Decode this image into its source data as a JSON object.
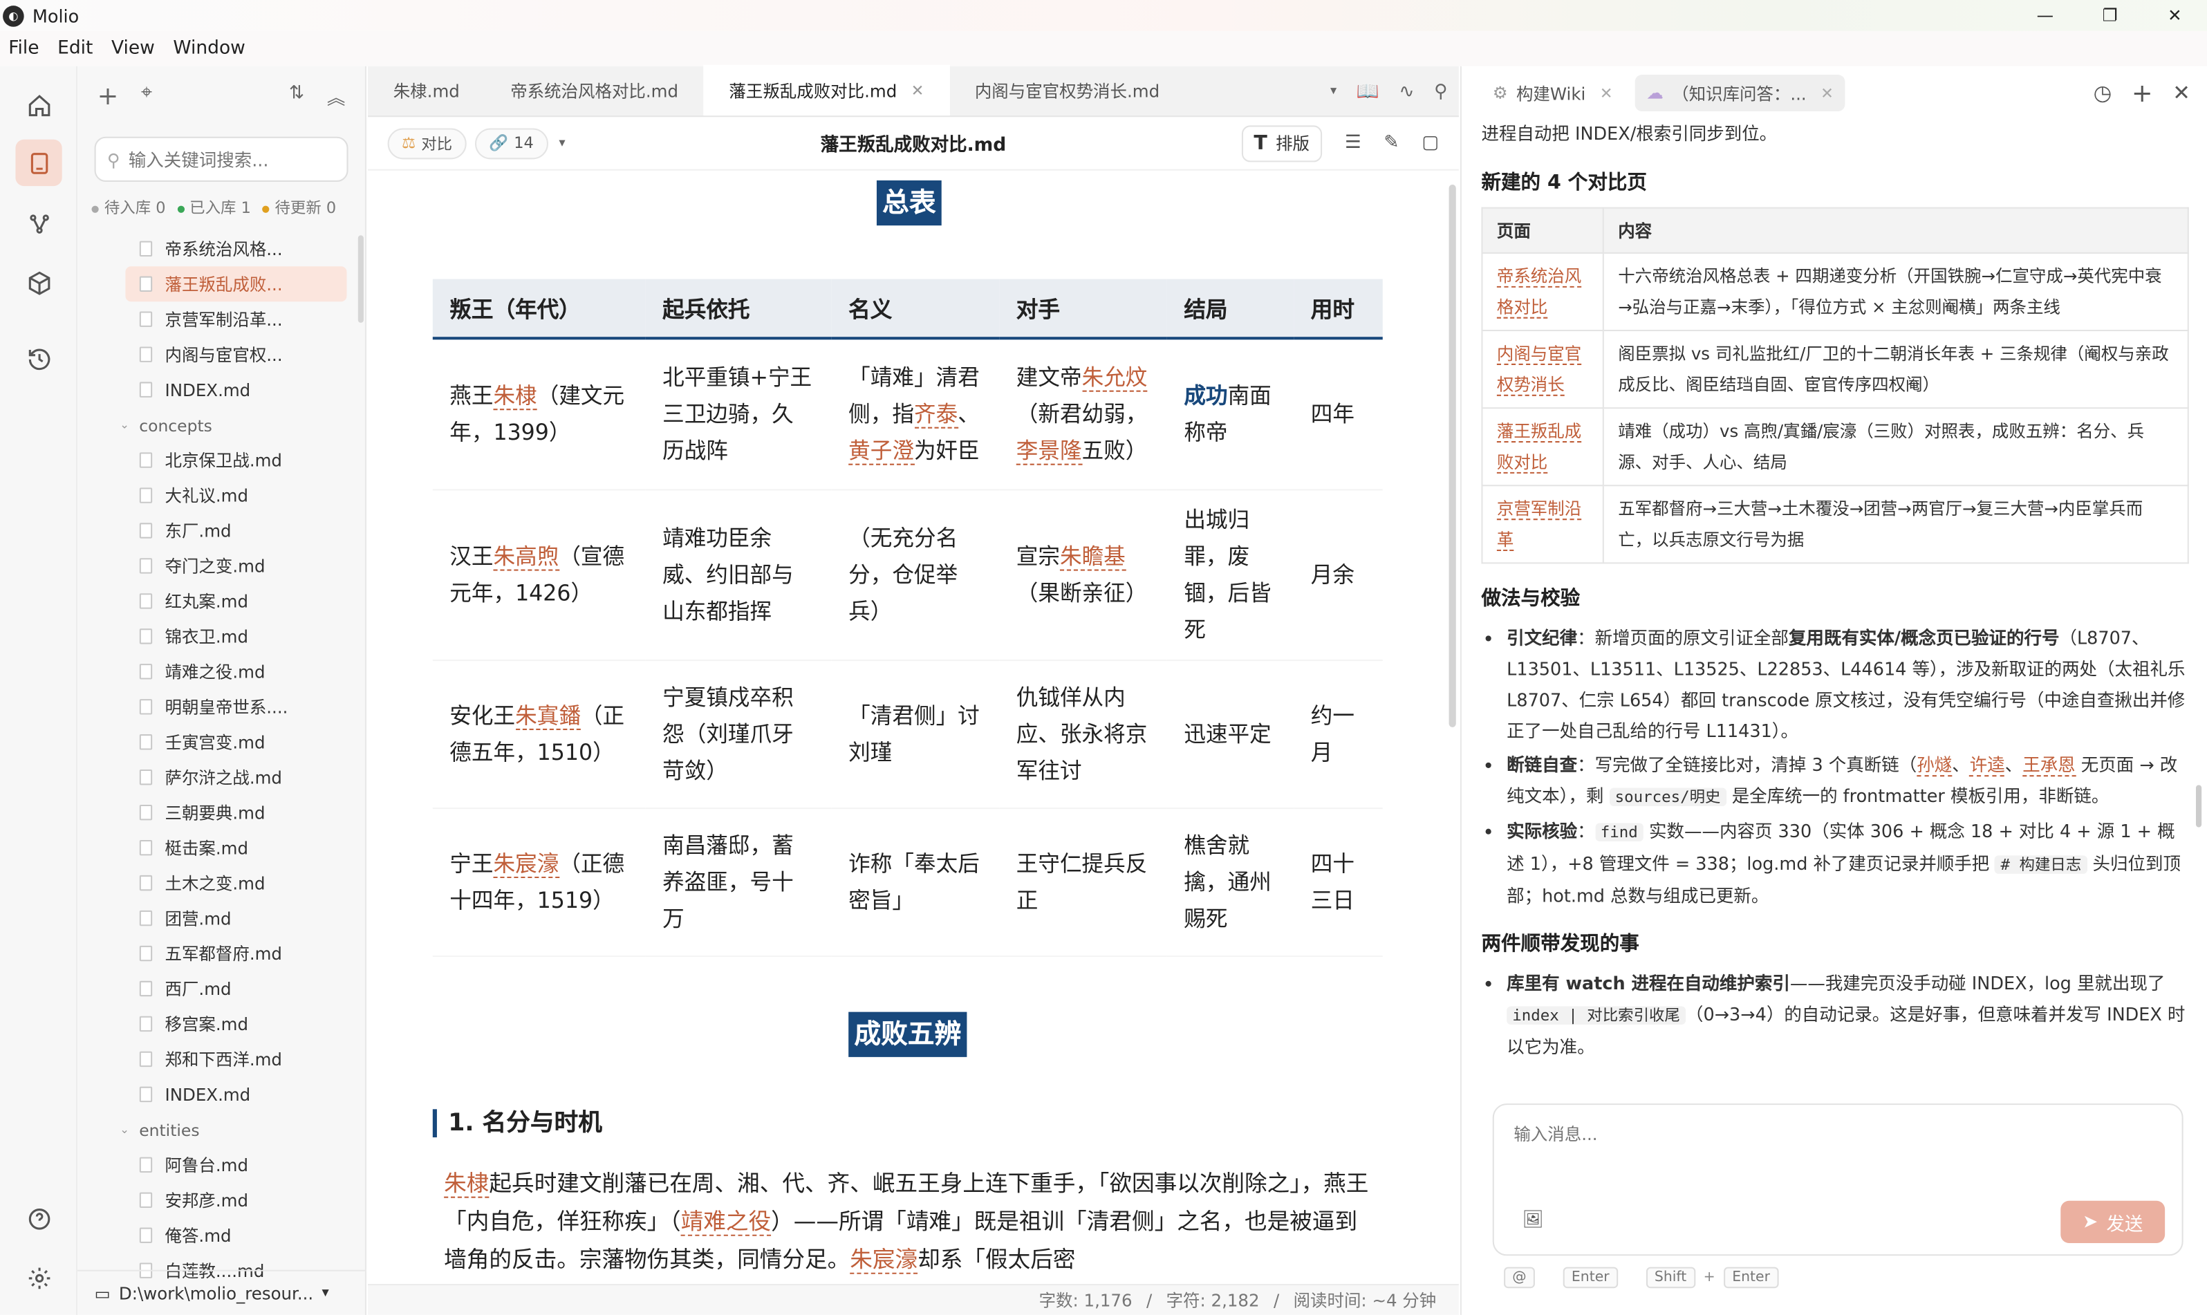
{
  "app": {
    "title": "Molio",
    "window_controls": [
      "—",
      "❐",
      "✕"
    ]
  },
  "menu": [
    "File",
    "Edit",
    "View",
    "Window"
  ],
  "filepanel": {
    "search_placeholder": "输入关键词搜索...",
    "status": {
      "pending": "待入库 0",
      "stored": "已入库 1",
      "update": "待更新 0"
    },
    "files_top": [
      "帝系统治风格...",
      "藩王叛乱成败...",
      "京营军制沿革...",
      "内阁与宦官权...",
      "INDEX.md"
    ],
    "selected_index": 1,
    "folder_concepts": "concepts",
    "concepts": [
      "北京保卫战.md",
      "大礼议.md",
      "东厂.md",
      "夺门之变.md",
      "红丸案.md",
      "锦衣卫.md",
      "靖难之役.md",
      "明朝皇帝世系....",
      "壬寅宫变.md",
      "萨尔浒之战.md",
      "三朝要典.md",
      "梃击案.md",
      "土木之变.md",
      "团营.md",
      "五军都督府.md",
      "西厂.md",
      "移宫案.md",
      "郑和下西洋.md",
      "INDEX.md"
    ],
    "folder_entities": "entities",
    "entities": [
      "阿鲁台.md",
      "安邦彦.md",
      "俺答.md",
      "白莲教....md"
    ],
    "workspace_path": "D:\\work\\molio_resour..."
  },
  "editor": {
    "tabs": [
      "朱棣.md",
      "帝系统治风格对比.md",
      "藩王叛乱成败对比.md",
      "内阁与宦官权势消长.md"
    ],
    "active_tab": 2,
    "pill_compare": "对比",
    "pill_links": "14",
    "doc_title": "藩王叛乱成败对比.md",
    "paiban": "排版",
    "banner1": "总表",
    "banner2": "成败五辨",
    "table_headers": [
      "叛王（年代）",
      "起兵依托",
      "名义",
      "对手",
      "结局",
      "用时"
    ],
    "rows": [
      {
        "c1a": "燕王",
        "c1b": "朱棣",
        "c1c": "（建文元年，1399）",
        "c2": "北平重镇+宁王三卫边骑，久历战阵",
        "c3a": "「靖难」清君侧，指",
        "c3b": "齐泰",
        "c3c": "、",
        "c3d": "黄子澄",
        "c3e": "为奸臣",
        "c4a": "建文帝",
        "c4b": "朱允炆",
        "c4c": "（新君幼弱，",
        "c4d": "李景隆",
        "c4e": "五败）",
        "c5a": "成功",
        "c5b": "南面称帝",
        "c6": "四年"
      },
      {
        "c1a": "汉王",
        "c1b": "朱高煦",
        "c1c": "（宣德元年，1426）",
        "c2": "靖难功臣余威、约旧部与山东都指挥",
        "c3": "（无充分名分，仓促举兵）",
        "c4a": "宣宗",
        "c4b": "朱瞻基",
        "c4c": "（果断亲征）",
        "c5": "出城归罪，废锢，后皆死",
        "c6": "月余"
      },
      {
        "c1a": "安化王",
        "c1b": "朱寘鐇",
        "c1c": "（正德五年，1510）",
        "c2": "宁夏镇戍卒积怨（刘瑾爪牙苛敛）",
        "c3": "「清君侧」讨刘瑾",
        "c4": "仇钺佯从内应、张永将京军往讨",
        "c5": "迅速平定",
        "c6": "约一月"
      },
      {
        "c1a": "宁王",
        "c1b": "朱宸濠",
        "c1c": "（正德十四年，1519）",
        "c2": "南昌藩邸，蓄养盗匪，号十万",
        "c3": "诈称「奉太后密旨」",
        "c4": "王守仁提兵反正",
        "c5": "樵舍就擒，通州赐死",
        "c6": "四十三日"
      }
    ],
    "section_heading": "1. 名分与时机",
    "para": {
      "a": "朱棣",
      "b": "起兵时建文削藩已在周、湘、代、齐、岷五王身上连下重手，「欲因事以次削除之」，燕王「内自危，佯狂称疾」（",
      "c": "靖难之役",
      "d": "）——所谓「靖难」既是祖训「清君侧」之名，也是被逼到墙角的反击。宗藩物伤其类，同情分足。",
      "e": "朱宸濠",
      "f": "却系「假太后密"
    },
    "status_words": "字数: 1,176",
    "status_chars": "字符: 2,182",
    "status_read": "阅读时间: ~4 分钟"
  },
  "chat": {
    "tab1": "构建Wiki",
    "tab2": "（知识库问答：...",
    "intro": "进程自动把 INDEX/根索引同步到位。",
    "h_new": "新建的 4 个对比页",
    "th_page": "页面",
    "th_content": "内容",
    "pages": [
      {
        "page": "帝系统治风格对比",
        "content": "十六帝统治风格总表 + 四期递变分析（开国铁腕→仁宣守成→英代宪中衰→弘治与正嘉→末季），「得位方式 × 主忿则阉横」两条主线"
      },
      {
        "page": "内阁与宦官权势消长",
        "content": "阁臣票拟 vs 司礼监批红/厂卫的十二朝消长年表 + 三条规律（阉权与亲政成反比、阁臣结珰自固、宦官传序四权阉）"
      },
      {
        "page": "藩王叛乱成败对比",
        "content": "靖难（成功）vs 高煦/寘鐇/宸濠（三败）对照表，成败五辨：名分、兵源、对手、人心、结局"
      },
      {
        "page": "京营军制沿革",
        "content": "五军都督府→三大营→土木覆没→团营→两官厅→复三大营→内臣掌兵而亡，以兵志原文行号为据"
      }
    ],
    "h_method": "做法与校验",
    "b1_label": "引文纪律",
    "b1_t1": "：新增页面的原文引证全部",
    "b1_bold": "复用既有实体/概念页已验证的行号",
    "b1_t2": "（L8707、L13501、L13511、L13525、L22853、L44614 等），涉及新取证的两处（太祖礼乐 L8707、仁宗 L654）都回 transcode 原文核过，没有凭空编行号（中途自查揪出并修正了一处自己乱给的行号 L11431）。",
    "b2_label": "断链自查",
    "b2_t1": "：写完做了全链接比对，清掉 3 个真断链（",
    "b2_l1": "孙燧",
    "b2_sep1": "、",
    "b2_l2": "许逵",
    "b2_sep2": "、",
    "b2_l3": "王承恩",
    "b2_t2": " 无页面 → 改纯文本），剩 ",
    "b2_code": "sources/明史",
    "b2_t3": " 是全库统一的 frontmatter 模板引用，非断链。",
    "b3_label": "实际核验",
    "b3_t1": "：",
    "b3_code1": "find",
    "b3_t2": " 实数——内容页 330（实体 306 + 概念 18 + 对比 4 + 源 1 + 概述 1），+8 管理文件 = 338；log.md 补了建页记录并顺手把 ",
    "b3_code2": "# 构建日志",
    "b3_t3": " 头归位到顶部；hot.md 总数与组成已更新。",
    "h_two": "两件顺带发现的事",
    "c1_label": "库里有 watch 进程在自动维护索引",
    "c1_t1": "——我建完页没手动碰 INDEX，log 里就出现了 ",
    "c1_code": "index | 对比索引收尾",
    "c1_t2": "（0→3→4）的自动记录。这是好事，但意味着并发写 INDEX 时以它为准。",
    "input_placeholder": "输入消息...",
    "send": "发送",
    "hint_at": "@",
    "hint_enter": "Enter",
    "hint_shift": "Shift",
    "hint_plus": "+",
    "hint_enter2": "Enter"
  },
  "colors": {
    "accent": "#c05f3a",
    "navy": "#18487c",
    "selected_bg": "#fbe5dd",
    "send_btn": "#ebb0a0"
  }
}
